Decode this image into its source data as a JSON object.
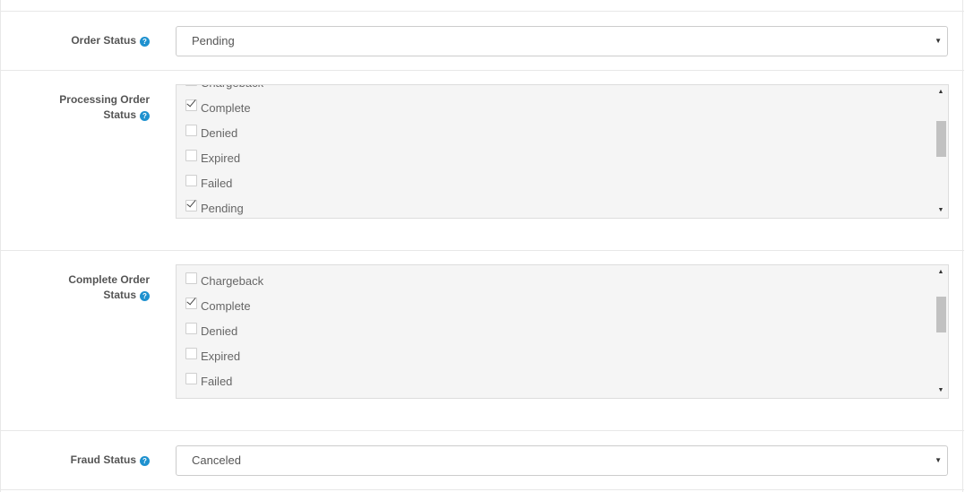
{
  "order_status": {
    "label": "Order Status",
    "selected": "Pending"
  },
  "processing_order_status": {
    "label_line1": "Processing Order",
    "label_line2": "Status",
    "items": [
      {
        "label": "Chargeback",
        "checked": false
      },
      {
        "label": "Complete",
        "checked": true
      },
      {
        "label": "Denied",
        "checked": false
      },
      {
        "label": "Expired",
        "checked": false
      },
      {
        "label": "Failed",
        "checked": false
      },
      {
        "label": "Pending",
        "checked": true
      }
    ]
  },
  "complete_order_status": {
    "label_line1": "Complete Order",
    "label_line2": "Status",
    "items": [
      {
        "label": "Chargeback",
        "checked": false
      },
      {
        "label": "Complete",
        "checked": true
      },
      {
        "label": "Denied",
        "checked": false
      },
      {
        "label": "Expired",
        "checked": false
      },
      {
        "label": "Failed",
        "checked": false
      }
    ]
  },
  "fraud_status": {
    "label": "Fraud Status",
    "selected": "Canceled"
  },
  "help_glyph": "?",
  "icons": {
    "help": "question-circle-icon",
    "select_arrow": "caret-down-icon",
    "scroll_up": "scroll-up-arrow-icon",
    "scroll_down": "scroll-down-arrow-icon"
  },
  "colors": {
    "help_icon": "#1e91cf",
    "well_background": "#f5f5f5",
    "border": "#cccccc"
  }
}
